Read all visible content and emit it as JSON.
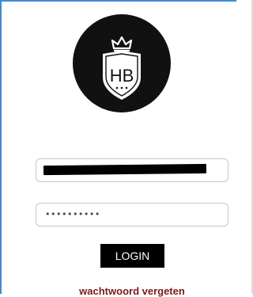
{
  "logo": {
    "monogram": "HB",
    "icon": "crown-shield-logo",
    "background_color": "#111111",
    "shield_color": "#ffffff"
  },
  "login_form": {
    "username_value": "",
    "password_value": "••••••••••",
    "login_label": "LOGIN",
    "forgot_password_label": "wachtwoord vergeten",
    "button_color": "#000000",
    "link_color": "#7a1a1a"
  }
}
